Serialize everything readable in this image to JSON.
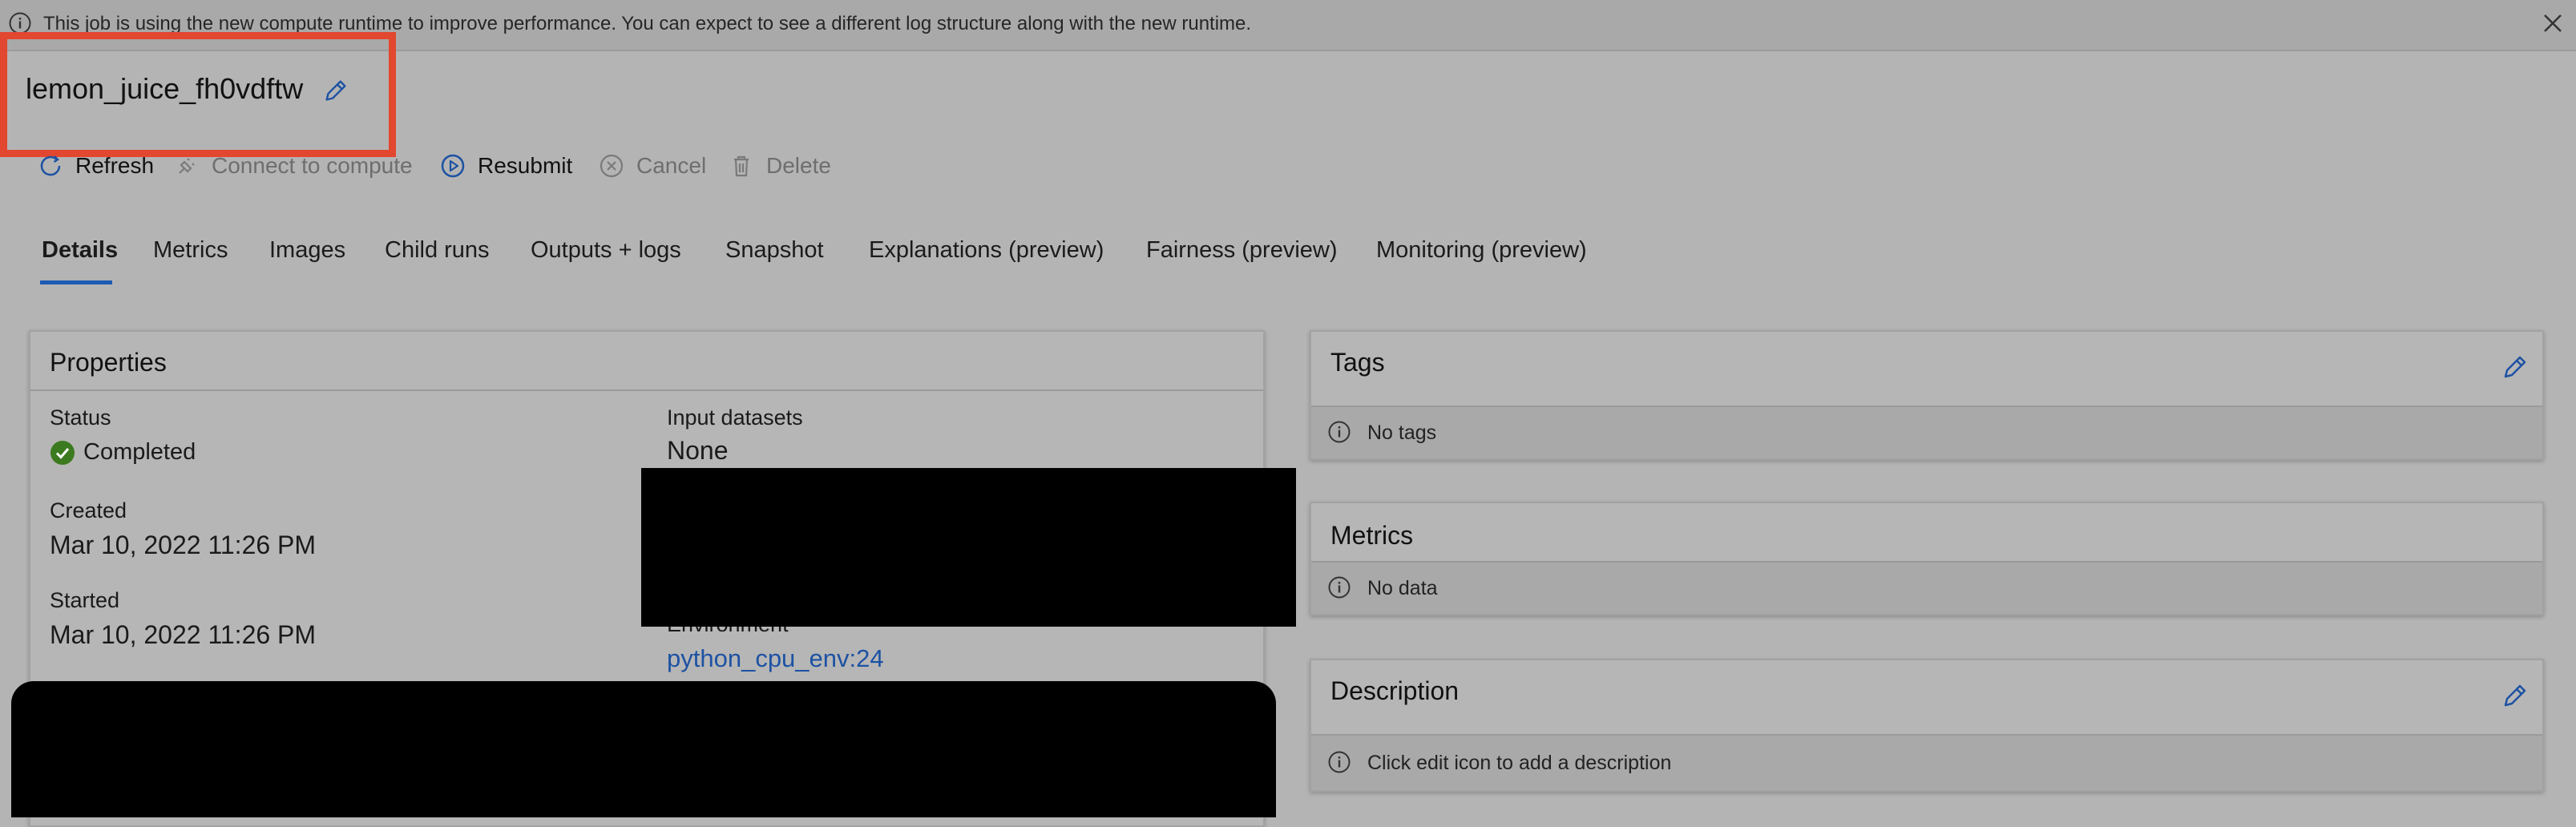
{
  "banner": {
    "text": "This job is using the new compute runtime to improve performance. You can expect to see a different log structure along with the new runtime."
  },
  "job": {
    "name": "lemon_juice_fh0vdftw"
  },
  "toolbar": {
    "refresh": "Refresh",
    "connect": "Connect to compute",
    "resubmit": "Resubmit",
    "cancel": "Cancel",
    "delete": "Delete"
  },
  "tabs": [
    {
      "label": "Details"
    },
    {
      "label": "Metrics"
    },
    {
      "label": "Images"
    },
    {
      "label": "Child runs"
    },
    {
      "label": "Outputs + logs"
    },
    {
      "label": "Snapshot"
    },
    {
      "label": "Explanations (preview)"
    },
    {
      "label": "Fairness (preview)"
    },
    {
      "label": "Monitoring (preview)"
    }
  ],
  "properties": {
    "title": "Properties",
    "status_label": "Status",
    "status_value": "Completed",
    "created_label": "Created",
    "created_value": "Mar 10, 2022 11:26 PM",
    "started_label": "Started",
    "started_value": "Mar 10, 2022 11:26 PM",
    "input_datasets_label": "Input datasets",
    "input_datasets_value": "None",
    "environment_label": "Environment",
    "environment_value": "python_cpu_env:24"
  },
  "tags": {
    "title": "Tags",
    "empty_text": "No tags"
  },
  "metrics": {
    "title": "Metrics",
    "empty_text": "No data"
  },
  "description": {
    "title": "Description",
    "hint_text": "Click edit icon to add a description"
  },
  "colors": {
    "accent": "#1d52a3",
    "success": "#3c7a1f",
    "highlight": "#e2472f"
  }
}
